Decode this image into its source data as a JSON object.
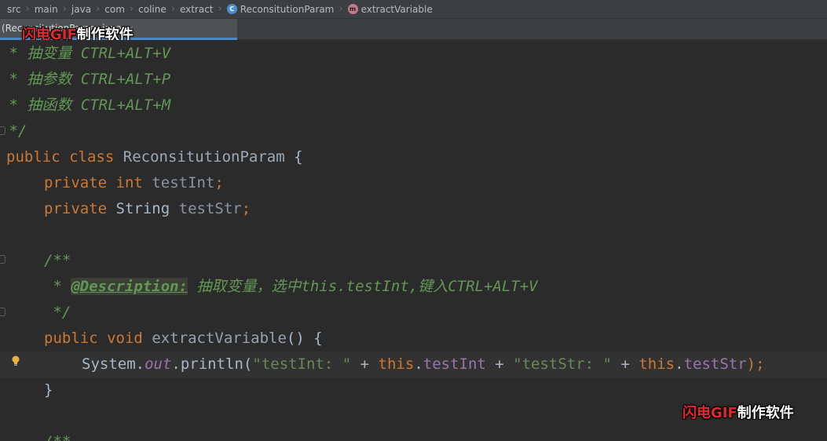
{
  "breadcrumb": {
    "items": [
      {
        "label": "src"
      },
      {
        "label": "main"
      },
      {
        "label": "java"
      },
      {
        "label": "com"
      },
      {
        "label": "coline"
      },
      {
        "label": "extract"
      },
      {
        "label": "ReconsitutionParam",
        "icon": "class-icon",
        "icon_letter": "C"
      },
      {
        "label": "extractVariable",
        "icon": "method-icon",
        "icon_letter": "m"
      }
    ]
  },
  "tab": {
    "label": "(ReconsitutionParam.java",
    "close": "×"
  },
  "watermark": {
    "part_a": "闪电GIF",
    "part_b": "制作软件"
  },
  "editor": {
    "colors": {
      "keyword": "#cc7832",
      "comment": "#629755",
      "field": "#9876aa",
      "string": "#6a8759",
      "text": "#a9b7c6",
      "background": "#2b2b2b",
      "current_line": "#323232"
    },
    "lines": [
      {
        "doc_star": " * ",
        "text": "抽变量 CTRL+ALT+V"
      },
      {
        "doc_star": " * ",
        "text": "抽参数 CTRL+ALT+P"
      },
      {
        "doc_star": " * ",
        "text": "抽函数 CTRL+ALT+M"
      },
      {
        "end": " */"
      },
      {
        "kw1": "public",
        "kw2": "class",
        "name": "ReconsitutionParam",
        "brace": " {"
      },
      {
        "kw": "private",
        "type": "int",
        "field": "testInt",
        "semi": ";"
      },
      {
        "kw": "private",
        "type": "String",
        "field": "testStr",
        "semi": ";"
      },
      {},
      {
        "open": "/**"
      },
      {
        "star": " * ",
        "tag": "@Description:",
        "desc": " 抽取变量，选中this.testInt,键入CTRL+ALT+V"
      },
      {
        "end": " */"
      },
      {
        "kw1": "public",
        "kw2": "void",
        "name": "extractVariable",
        "rest": "() {"
      },
      {
        "obj": "System",
        "dot1": ".",
        "out": "out",
        "call": ".println(",
        "s1": "\"testInt: \"",
        "plus1": " + ",
        "this1": "this",
        "dot2": ".",
        "f1": "testInt",
        "plus2": " + ",
        "s2": "\"testStr: \"",
        "plus3": " + ",
        "this2": "this",
        "dot3": ".",
        "f2": "testStr",
        "close": ");"
      },
      {
        "brace": "}"
      },
      {},
      {
        "open": "/**"
      }
    ]
  }
}
